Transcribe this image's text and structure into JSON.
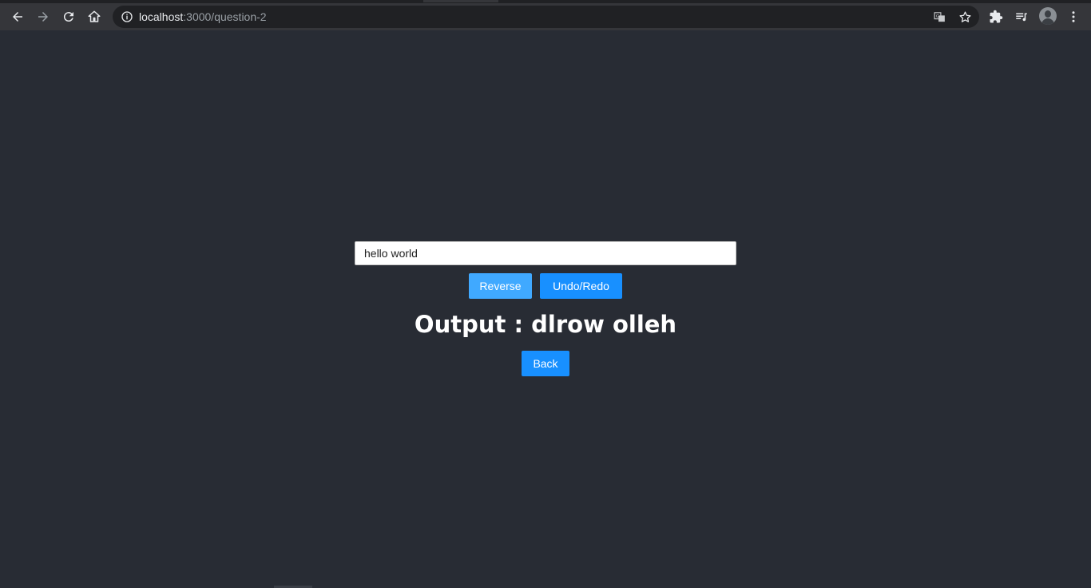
{
  "browser": {
    "url_host": "localhost",
    "url_path": ":3000/question-2",
    "icons": {
      "back": "arrow-left-icon",
      "forward": "arrow-right-icon",
      "reload": "reload-icon",
      "home": "home-icon",
      "site_info": "info-icon",
      "translate": "translate-icon",
      "bookmark": "star-icon",
      "extensions": "puzzle-icon",
      "media": "playlist-icon",
      "profile": "avatar",
      "menu": "kebab-menu-icon"
    }
  },
  "app": {
    "input_value": "hello world",
    "reverse_label": "Reverse",
    "undo_redo_label": "Undo/Redo",
    "output_text": "Output : dlrow olleh",
    "back_label": "Back"
  },
  "colors": {
    "page_background": "#282c34",
    "primary_button": "#1890ff",
    "hover_button": "#40a9ff"
  }
}
